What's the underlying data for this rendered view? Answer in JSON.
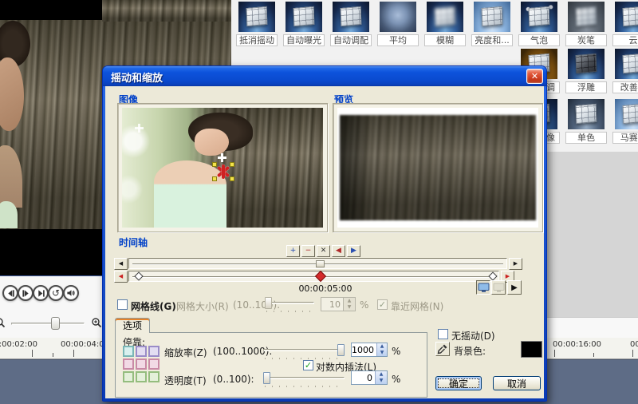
{
  "icons": {
    "close": "✕",
    "check": "✓",
    "up": "▲",
    "down": "▼",
    "arrow_left": "◀",
    "arrow_right": "▶",
    "play": "▶",
    "repeat": "↺",
    "prev_frame": "svg-triangle-left-bar",
    "next_frame": "svg-bar-triangle-right",
    "end": "svg-triangle-right-bar",
    "volume": "svg-speaker",
    "zoom_out": "svg-magnifier",
    "zoom_in": "svg-magnifier-plus",
    "eyedropper": "svg-dropper",
    "monitor": "svg-monitor"
  },
  "gallery": {
    "items": [
      {
        "label": "抵消摇动",
        "row": 1,
        "col": 1,
        "tint": "steel"
      },
      {
        "label": "自动曝光",
        "row": 1,
        "col": 2,
        "tint": "steel"
      },
      {
        "label": "自动调配",
        "row": 1,
        "col": 3,
        "tint": "steel"
      },
      {
        "label": "平均",
        "row": 1,
        "col": 4,
        "tint": "blur"
      },
      {
        "label": "模糊",
        "row": 1,
        "col": 5,
        "tint": "blur2"
      },
      {
        "label": "亮度和...",
        "row": 1,
        "col": 6,
        "tint": "bright"
      },
      {
        "label": "气泡",
        "row": 1,
        "col": 7,
        "tint": "shatter"
      },
      {
        "label": "炭笔",
        "row": 1,
        "col": 8,
        "tint": "smoke"
      },
      {
        "label": "云",
        "row": 1,
        "col": 9,
        "tint": "steel"
      },
      {
        "label": "调",
        "row": 2,
        "col": 7,
        "tint": "gold",
        "cut": true
      },
      {
        "label": "浮雕",
        "row": 2,
        "col": 8,
        "tint": "dark"
      },
      {
        "label": "改善...",
        "row": 2,
        "col": 9,
        "tint": "steel"
      },
      {
        "label": "像",
        "row": 3,
        "col": 7,
        "tint": "steel",
        "cut": true
      },
      {
        "label": "单色",
        "row": 3,
        "col": 8,
        "tint": "mono"
      },
      {
        "label": "马赛...",
        "row": 3,
        "col": 9,
        "tint": "bright"
      }
    ]
  },
  "player": {
    "timecode_a": "00:00:02:00",
    "timecode_b": "00:00:04:00"
  },
  "right_ruler": {
    "timecode": "00:00:16:00",
    "timecode_partial": "00"
  },
  "dialog": {
    "title": "摇动和缩放",
    "image_panel_label": "图像",
    "preview_panel_label": "预览",
    "timeline": {
      "label": "时间轴",
      "toolbar": [
        {
          "name": "add-keyframe-button",
          "glyph": "+",
          "color": "#2a4fb0"
        },
        {
          "name": "remove-keyframe-button",
          "glyph": "−",
          "color": "#b02a2a"
        },
        {
          "name": "delete-keyframes-button",
          "glyph": "✕",
          "color": "#333333"
        },
        {
          "name": "prev-keyframe-button",
          "glyph": "◀",
          "color": "#b02a2a"
        },
        {
          "name": "next-keyframe-button",
          "glyph": "▶",
          "color": "#2a4fb0"
        }
      ],
      "timestamp": "00:00:05:00"
    },
    "grid": {
      "gridlines_label": "网格线(G)",
      "size_label": "网格大小(R)",
      "size_range": "(10..100):",
      "size_value": "10",
      "percent": "%",
      "snap_label": "靠近网格(N)"
    },
    "options": {
      "tab_label": "选项",
      "anchor_label": "停靠:",
      "anchor_cells": [
        {
          "fill": "#d9f0ef",
          "border": "#79b6b6"
        },
        {
          "fill": "#e3ddf2",
          "border": "#9a8cc8"
        },
        {
          "fill": "#e3ddf2",
          "border": "#9a8cc8"
        },
        {
          "fill": "#f2dae5",
          "border": "#c98aa6"
        },
        {
          "fill": "#f2dae5",
          "border": "#c98aa6"
        },
        {
          "fill": "#f2dae5",
          "border": "#c98aa6"
        },
        {
          "fill": "#e4f0da",
          "border": "#94bd7e"
        },
        {
          "fill": "#e4f0da",
          "border": "#94bd7e"
        },
        {
          "fill": "#e4f0da",
          "border": "#94bd7e"
        }
      ],
      "zoom_label": "缩放率(Z)",
      "zoom_range": "(100..1000):",
      "zoom_value": "1000",
      "log_label": "对数内插法(L)",
      "opacity_label": "透明度(T)",
      "opacity_range": "(0..100):",
      "opacity_value": "0",
      "percent": "%",
      "no_pan_label": "无摇动(D)",
      "bg_color_label": "背景色:",
      "bg_color_value": "#000000"
    },
    "ok_label": "确定",
    "cancel_label": "取消"
  }
}
